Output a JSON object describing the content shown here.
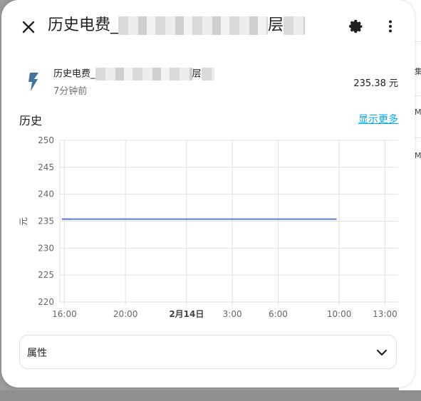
{
  "dialog": {
    "title_prefix": "历史电费_",
    "title_suffix": "层",
    "icons": {
      "close": "close-icon",
      "settings": "gear-icon",
      "more": "more-vertical-icon"
    }
  },
  "entity": {
    "icon": "lightning-bolt-icon",
    "name_prefix": "历史电费_",
    "name_suffix": "层",
    "last_changed": "7分钟前",
    "state": "235.38 元"
  },
  "history": {
    "title": "历史",
    "show_more": "显示更多"
  },
  "chart_data": {
    "type": "line",
    "ylabel": "元",
    "ylim": [
      220,
      250
    ],
    "yticks": [
      250,
      245,
      240,
      235,
      230,
      225,
      220
    ],
    "x_tick_labels": [
      "16:00",
      "20:00",
      "2月14日",
      "3:00",
      "6:00",
      "10:00",
      "13:00"
    ],
    "bold_tick": "2月14日",
    "grid": true,
    "series": [
      {
        "color": "#5b7fd6",
        "segments": [
          {
            "x": [
              "15:50",
              "16:25"
            ],
            "y": [
              235.38,
              235.38
            ]
          },
          {
            "x": [
              "09:50",
              "15:50"
            ],
            "y": [
              235.38,
              235.38
            ]
          }
        ]
      }
    ]
  },
  "attributes": {
    "label": "属性",
    "chevron": "chevron-down-icon"
  },
  "backdrop": {
    "row_text": [
      "集",
      "M",
      "M"
    ]
  }
}
